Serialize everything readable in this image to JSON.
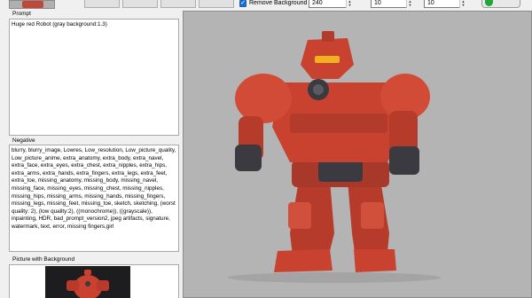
{
  "toolbar": {
    "buttons": [
      "",
      "",
      "",
      ""
    ],
    "remove_background_label": "Remove Background",
    "remove_background_checked": true,
    "fields": [
      {
        "value": "240"
      },
      {
        "value": "10"
      },
      {
        "value": "10"
      }
    ]
  },
  "prompt": {
    "label": "Prompt",
    "text": "Huge red Robot (gray background:1.3)"
  },
  "negative": {
    "label": "Negative",
    "text": "blurry, blurry_image, Lowres, Low_resolution, Low_picture_quality, Low_picture_anime, extra_anatomy, extra_body, extra_navel, extra_face, extra_eyes, extra_chest, extra_nipples, extra_hips, extra_arms, extra_hands, extra_fingers, extra_legs, extra_feet, extra_toe, missing_anatomy, missing_body, missing_navel, missing_face, missing_eyes, missing_chest, missing_nipples, missing_hips, missing_arms, missing_hands, missing_fingers, missing_legs, missing_feet, missing_toe, sketch, sketching, (worst quality: 2), (low quality:2), ((monochrome)), ((grayscale)), inpainting, HDR, bad_prompt_version2, jpeg artifacts, signature, watermark, text, error, missing fingers,girl"
  },
  "picture_with_background": {
    "label": "Picture with Background"
  },
  "colors": {
    "robot_red": "#c9412f",
    "robot_dark": "#3a3a40",
    "canvas_bg": "#b4b4b4",
    "accent_blue": "#1a6fd1",
    "run_green": "#20a63a"
  }
}
